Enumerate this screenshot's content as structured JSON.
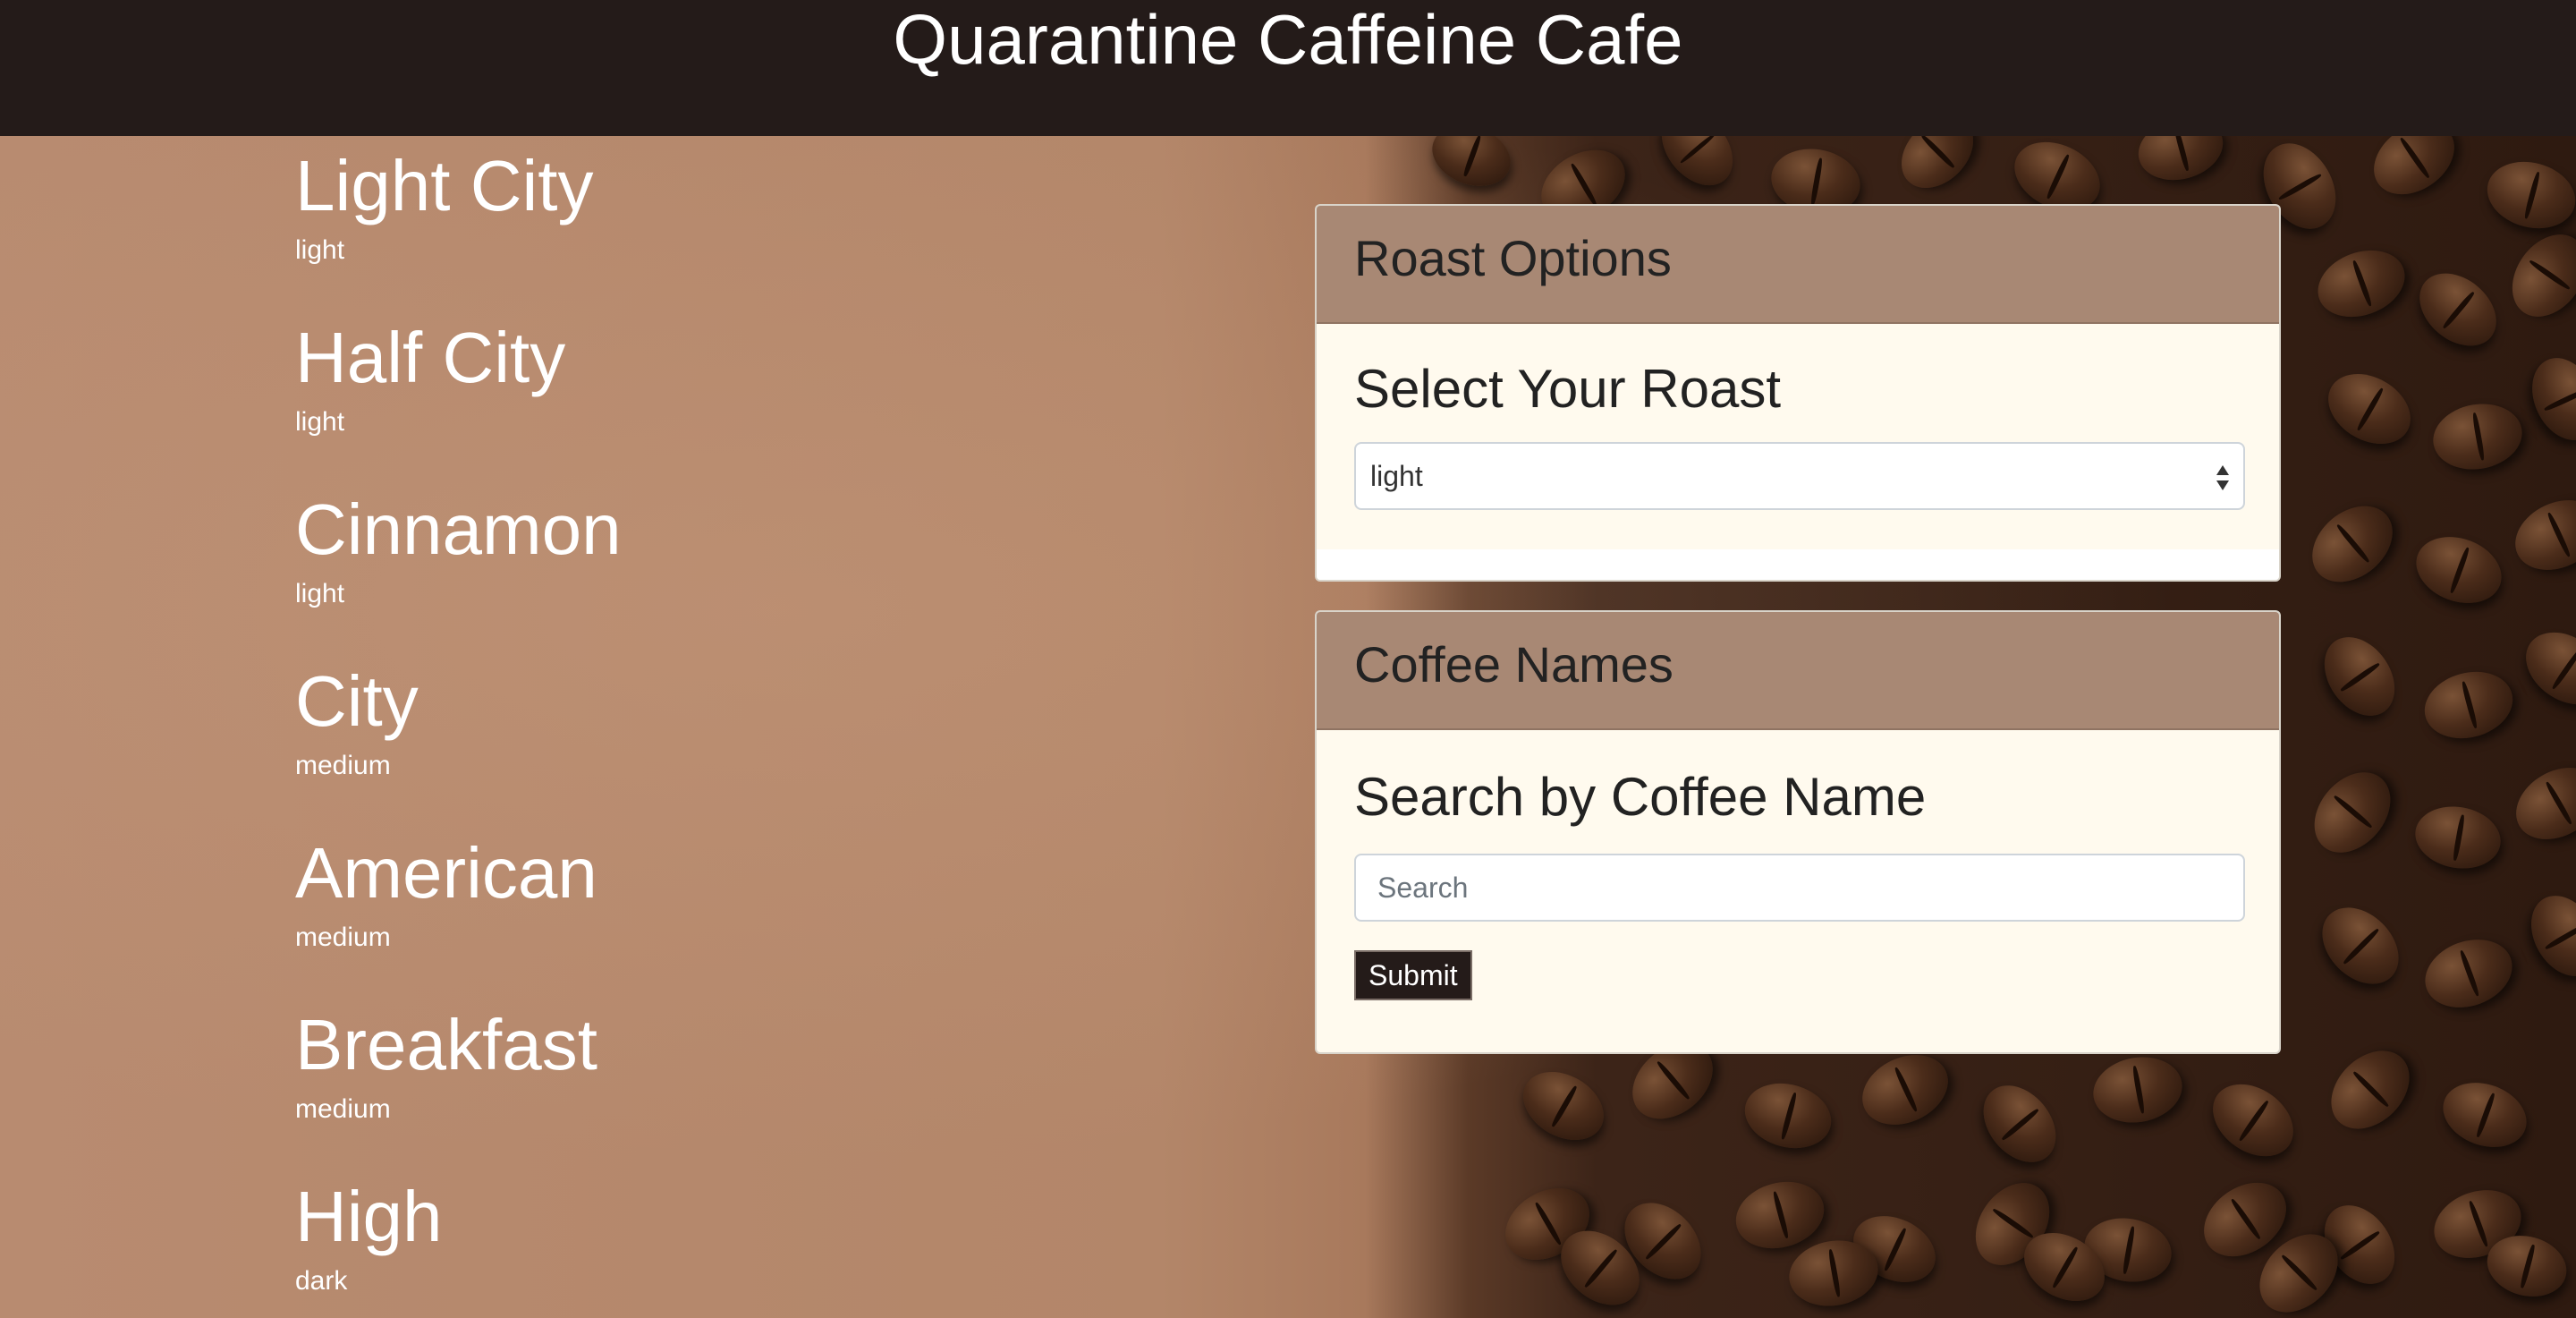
{
  "header": {
    "title": "Quarantine Caffeine Cafe"
  },
  "coffees": [
    {
      "name": "Light City",
      "roast": "light"
    },
    {
      "name": "Half City",
      "roast": "light"
    },
    {
      "name": "Cinnamon",
      "roast": "light"
    },
    {
      "name": "City",
      "roast": "medium"
    },
    {
      "name": "American",
      "roast": "medium"
    },
    {
      "name": "Breakfast",
      "roast": "medium"
    },
    {
      "name": "High",
      "roast": "dark"
    }
  ],
  "roast_card": {
    "header": "Roast Options",
    "title": "Select Your Roast",
    "selected_value": "light"
  },
  "names_card": {
    "header": "Coffee Names",
    "title": "Search by Coffee Name",
    "search_placeholder": "Search",
    "search_value": "",
    "submit_label": "Submit"
  },
  "colors": {
    "header_bg": "#241b19",
    "card_header_bg": "#a88874",
    "card_body_bg": "#fffaee",
    "button_bg": "#241b19"
  }
}
